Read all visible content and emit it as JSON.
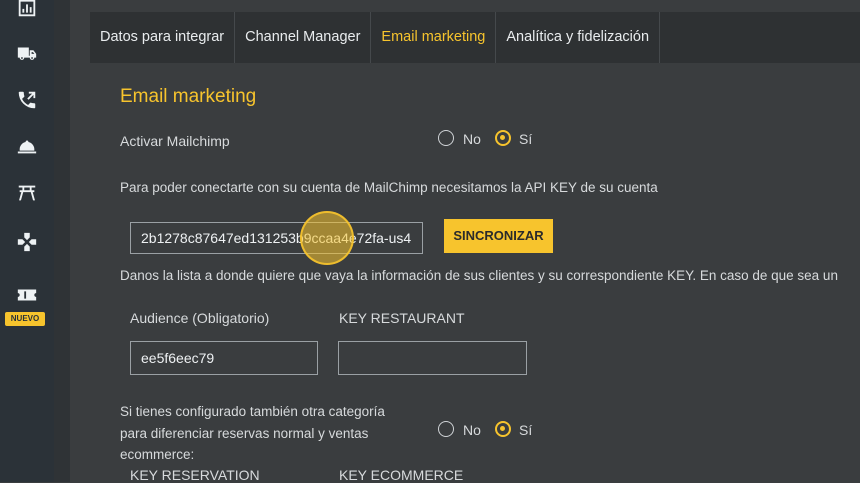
{
  "sidebar": {
    "icons": [
      "chart-icon",
      "truck-icon",
      "phone-icon",
      "room-service-icon",
      "sign-icon",
      "gamepad-icon",
      "ticket-icon"
    ],
    "new_badge": "NUEVO"
  },
  "tabs": [
    {
      "label": "Datos para integrar",
      "active": false
    },
    {
      "label": "Channel Manager",
      "active": false
    },
    {
      "label": "Email marketing",
      "active": true
    },
    {
      "label": "Analítica y fidelización",
      "active": false
    }
  ],
  "section": {
    "title": "Email marketing",
    "activate_label": "Activar Mailchimp",
    "radio_no": "No",
    "radio_yes": "Sí",
    "activate_value": "Sí",
    "api_intro": "Para poder conectarte con su cuenta de MailChimp necesitamos la API KEY de su cuenta",
    "api_key_value": "2b1278c87647ed131253b9ccaa4e72fa-us4",
    "sync_button": "SINCRONIZAR",
    "list_intro": "Danos la lista a donde quiere que vaya la información de sus clientes y su correspondiente KEY. En caso de que sea un",
    "audience_label": "Audience (Obligatorio)",
    "audience_value": "ee5f6eec79",
    "key_restaurant_label": "KEY RESTAURANT",
    "key_restaurant_value": "",
    "category_question": {
      "line1": "Si tienes configurado también otra categoría",
      "line2": "para diferenciar reservas normal y ventas",
      "line3": "ecommerce:"
    },
    "category_value": "Sí",
    "key_reservation_label": "KEY RESERVATION",
    "key_ecommerce_label": "KEY ECOMMERCE"
  },
  "colors": {
    "accent": "#f7c42d",
    "background": "#3a3d3f",
    "sidebar": "#2b3238"
  }
}
